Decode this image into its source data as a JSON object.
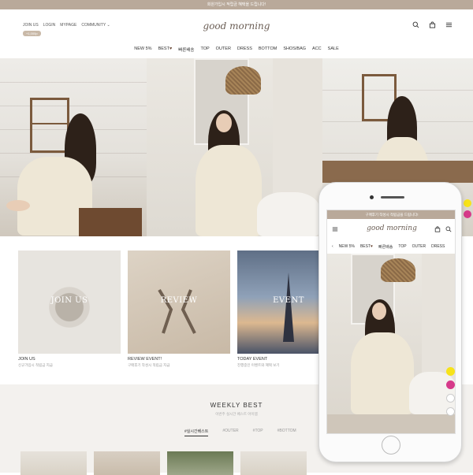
{
  "promo": {
    "text": "회원가입시 적립금 혜택을 드립니다!"
  },
  "header": {
    "logo": "good morning",
    "util": {
      "join": "JOIN US",
      "login": "LOGIN",
      "mypage": "MYPAGE",
      "community": "COMMUNITY"
    },
    "pill": "+1,000p",
    "icons": [
      "search-icon",
      "bag-icon",
      "menu-icon"
    ]
  },
  "nav": {
    "items": [
      "NEW 5%",
      "BEST",
      "빠른배송",
      "TOP",
      "OUTER",
      "DRESS",
      "BOTTOM",
      "SHOS/BAG",
      "ACC",
      "SALE"
    ],
    "heart": "♥"
  },
  "cards": [
    {
      "img_text": "JOIN US",
      "title": "JOIN US",
      "sub": "신규가입시 적립금 지급"
    },
    {
      "img_text": "REVIEW",
      "title": "REVIEW EVENT!",
      "sub": "구매후기 작성시 적립금 지급"
    },
    {
      "img_text": "EVENT",
      "title": "TODAY EVENT",
      "sub": "진행중인 이벤트와 혜택 보기"
    }
  ],
  "weekly": {
    "title": "WEEKLY BEST",
    "sub": "이번주 실시간 베스트 아이템",
    "tabs": [
      "#실시간베스트",
      "#OUTER",
      "#TOP",
      "#BOTTOM"
    ]
  },
  "phone": {
    "promo": "구매후기 작성시 적립금을 드립니다!",
    "logo": "good morning",
    "nav": [
      "NEW 5%",
      "BEST",
      "빠른배송",
      "TOP",
      "OUTER",
      "DRESS"
    ]
  },
  "colors": {
    "promo_bg": "#b9a99a",
    "kakao": "#f7e319",
    "instagram": "#d63a8a",
    "weekly_bg": "#f3f1ee"
  }
}
